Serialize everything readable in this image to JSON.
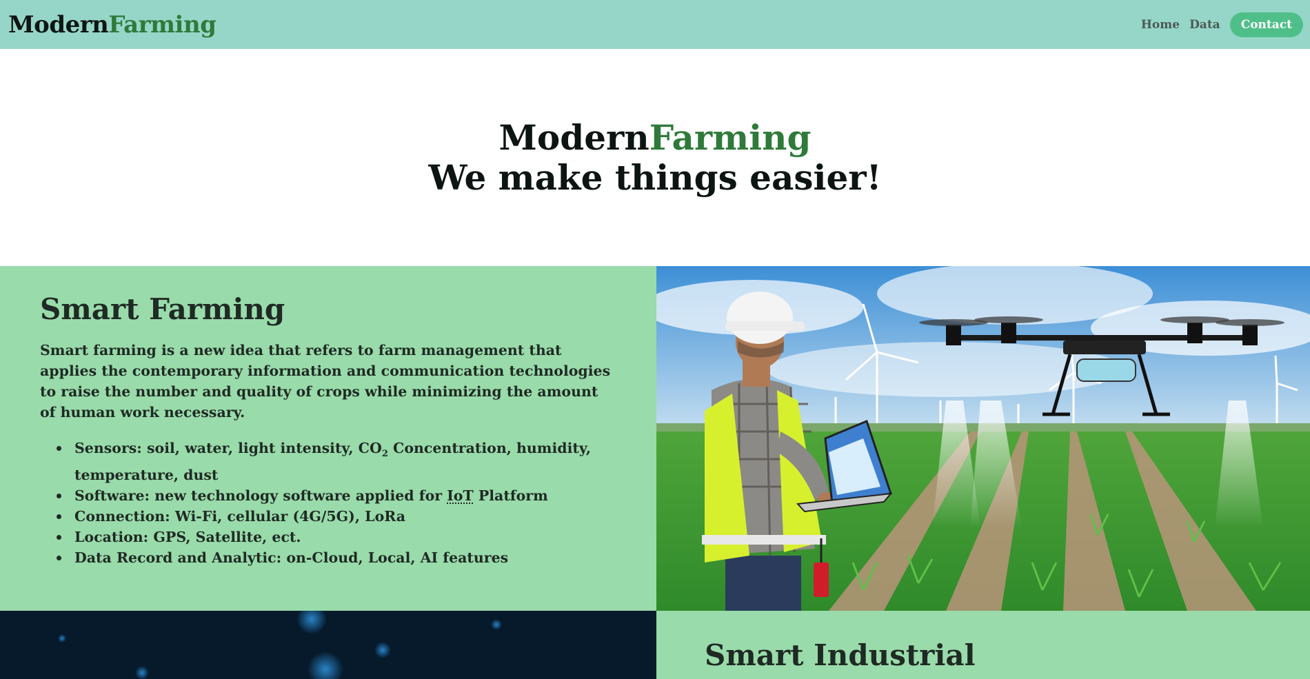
{
  "navbar": {
    "brand_part1": "Modern",
    "brand_part2": "Farming",
    "links": {
      "home": "Home",
      "data": "Data",
      "contact": "Contact"
    }
  },
  "hero": {
    "title_part1": "Modern",
    "title_part2": "Farming",
    "tagline": "We make things easier!"
  },
  "smart_farming": {
    "title": "Smart Farming",
    "description": "Smart farming is a new idea that refers to farm management that applies the contemporary information and communication technologies to raise the number and quality of crops while minimizing the amount of human work necessary.",
    "bullets": {
      "sensors_prefix": "Sensors: soil, water, light intensity, CO",
      "sensors_sub": "2",
      "sensors_suffix": " Concentration, humidity, temperature, dust",
      "software_prefix": "Software: new technology software applied for ",
      "software_abbr": "IoT",
      "software_suffix": " Platform",
      "connection": "Connection: Wi-Fi, cellular (4G/5G), LoRa",
      "location": "Location: GPS, Satellite, ect.",
      "data_record": "Data Record and Analytic: on-Cloud, Local, AI features"
    }
  },
  "smart_industrial": {
    "title": "Smart Industrial"
  },
  "colors": {
    "navbar_bg": "#96d6c8",
    "accent_green": "#2f7a3a",
    "section_bg": "#99dbaa",
    "contact_button": "#4fbf8a",
    "dark_panel": "#061a2c"
  },
  "images": {
    "drone_photo": "farmer-with-laptop-and-drone-icon",
    "tech_background": "digital-particles-background-icon"
  }
}
